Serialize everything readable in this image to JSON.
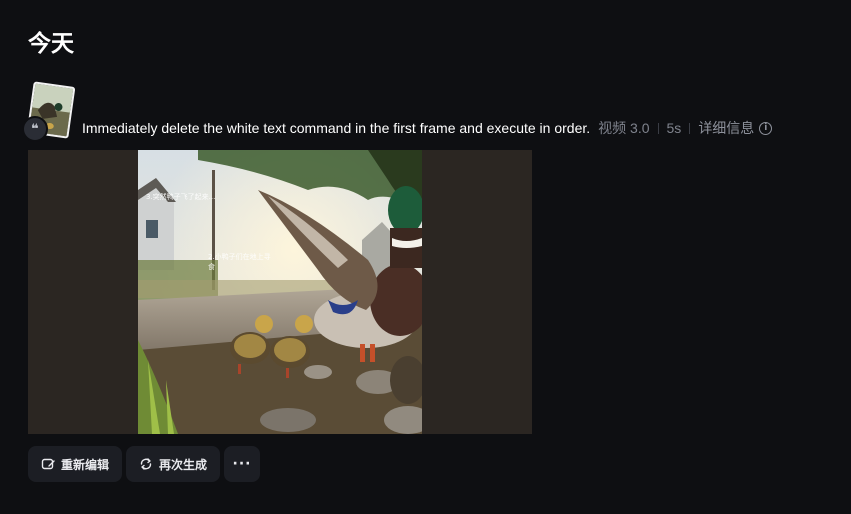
{
  "section": {
    "title": "今天"
  },
  "quote_icon": "quote-icon",
  "prompt": {
    "text": "Immediately delete the white text command in the first frame and execute in order.",
    "model": "视频 3.0",
    "duration": "5s",
    "detail_label": "详细信息",
    "detail_icon": "info-icon"
  },
  "video": {
    "overlay_lines": [
      "3.突然鸭子飞了起来...",
      "2.小鸭子们在地上寻",
      "食"
    ]
  },
  "actions": {
    "reedit_label": "重新编辑",
    "reedit_icon": "edit-icon",
    "regenerate_label": "再次生成",
    "regenerate_icon": "refresh-icon",
    "more_label": "···",
    "more_icon": "more-icon"
  },
  "colors": {
    "background": "#0e0f12",
    "button_bg": "#1c1e24",
    "meta_text": "#7f838d",
    "letterbox": "#2b2622"
  }
}
